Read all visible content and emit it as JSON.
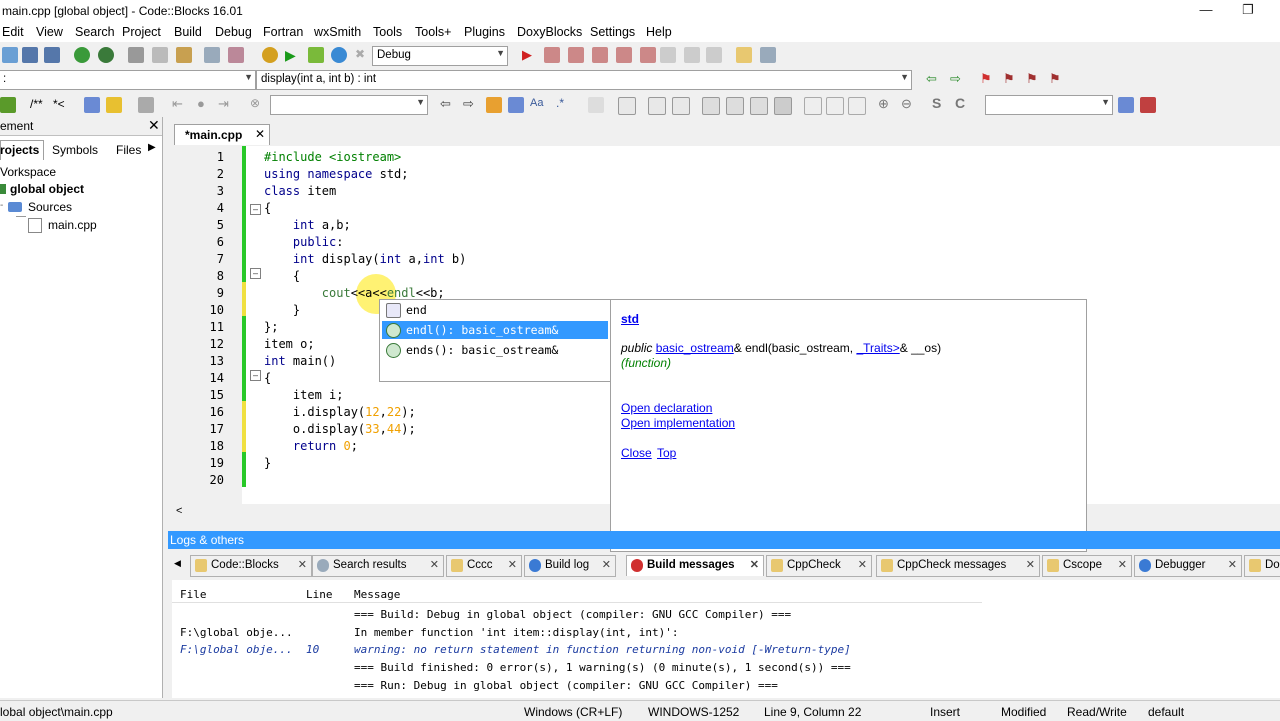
{
  "window": {
    "title": "main.cpp [global object] - Code::Blocks 16.01"
  },
  "menu": [
    "Edit",
    "View",
    "Search",
    "Project",
    "Build",
    "Debug",
    "Fortran",
    "wxSmith",
    "Tools",
    "Tools+",
    "Plugins",
    "DoxyBlocks",
    "Settings",
    "Help"
  ],
  "toolbar": {
    "build_target": "Debug",
    "scope_value": ":",
    "function_value": "display(int a, int b) : int",
    "search_value": "",
    "comment_label1": "/**",
    "comment_label2": "*<"
  },
  "management": {
    "title": "ement",
    "tabs": [
      "rojects",
      "Symbols",
      "Files"
    ],
    "tree": {
      "workspace": "Vorkspace",
      "project": "global object",
      "folder": "Sources",
      "file": "main.cpp"
    }
  },
  "editor": {
    "tab_label": "*main.cpp",
    "lines": [
      "1",
      "2",
      "3",
      "4",
      "5",
      "6",
      "7",
      "8",
      "9",
      "10",
      "11",
      "12",
      "13",
      "14",
      "15",
      "16",
      "17",
      "18",
      "19",
      "20"
    ]
  },
  "autocomplete": {
    "items": [
      {
        "text": "end",
        "selected": false
      },
      {
        "text": "endl(): basic_ostream&",
        "selected": true
      },
      {
        "text": "ends(): basic_ostream&",
        "selected": false
      }
    ]
  },
  "doc_popup": {
    "namespace": "std",
    "sig_prefix": "public",
    "sig_type": "basic_ostream",
    "sig_mid": "& endl(basic_ostream,",
    "sig_traits": "_Traits>",
    "sig_tail": "& __os)",
    "kind": "(function)",
    "open_decl": "Open declaration",
    "open_impl": "Open implementation",
    "close": "Close",
    "top": "Top"
  },
  "logs": {
    "title": "Logs & others",
    "tabs": [
      "Code::Blocks",
      "Search results",
      "Cccc",
      "Build log",
      "Build messages",
      "CppCheck",
      "CppCheck messages",
      "Cscope",
      "Debugger",
      "Do"
    ],
    "columns": [
      "File",
      "Line",
      "Message"
    ],
    "rows": [
      {
        "file": "",
        "line": "",
        "message": "=== Build: Debug in global object (compiler: GNU GCC Compiler) ==="
      },
      {
        "file": "F:\\global obje...",
        "line": "",
        "message": "In member function 'int item::display(int, int)':"
      },
      {
        "file": "F:\\global obje...",
        "line": "10",
        "message": "warning: no return statement in function returning non-void [-Wreturn-type]"
      },
      {
        "file": "",
        "line": "",
        "message": "=== Build finished: 0 error(s), 1 warning(s) (0 minute(s), 1 second(s)) ==="
      },
      {
        "file": "",
        "line": "",
        "message": "=== Run: Debug in global object (compiler: GNU GCC Compiler) ==="
      }
    ]
  },
  "status": {
    "path": "lobal object\\main.cpp",
    "eol": "Windows (CR+LF)",
    "encoding": "WINDOWS-1252",
    "position": "Line 9, Column 22",
    "mode": "Insert",
    "modified": "Modified",
    "access": "Read/Write",
    "lang": "default"
  }
}
